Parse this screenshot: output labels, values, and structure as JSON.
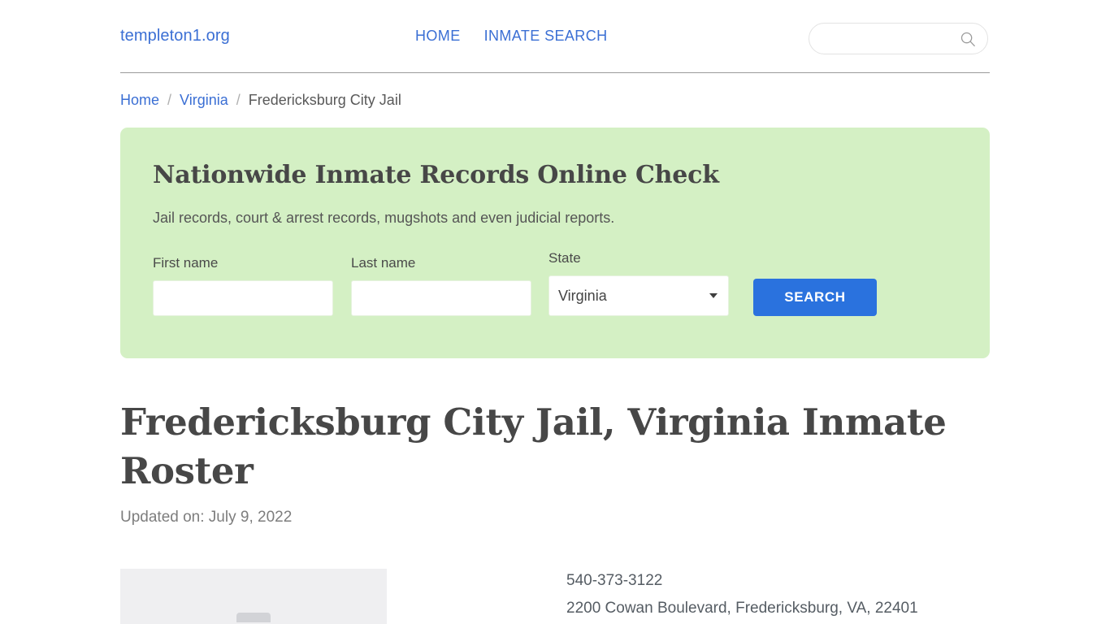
{
  "header": {
    "brand": "templeton1.org",
    "nav": [
      {
        "label": "HOME"
      },
      {
        "label": "INMATE SEARCH"
      }
    ],
    "search": {
      "value": "",
      "placeholder": "",
      "icon": "search-icon"
    }
  },
  "breadcrumb": {
    "items": [
      {
        "label": "Home",
        "type": "link"
      },
      {
        "label": "Virginia",
        "type": "link"
      },
      {
        "label": "Fredericksburg City Jail",
        "type": "current"
      }
    ],
    "separator": "/"
  },
  "search_panel": {
    "title": "Nationwide Inmate Records Online Check",
    "subtitle": "Jail records, court & arrest records, mugshots and even judicial reports.",
    "background_color": "#d4f0c4",
    "fields": {
      "first_name": {
        "label": "First name",
        "value": "",
        "placeholder": ""
      },
      "last_name": {
        "label": "Last name",
        "value": "",
        "placeholder": ""
      },
      "state": {
        "label": "State",
        "selected": "Virginia",
        "options": [
          "Virginia"
        ]
      }
    },
    "submit": {
      "label": "SEARCH",
      "color": "#2a72de"
    }
  },
  "main": {
    "title": "Fredericksburg City Jail, Virginia Inmate Roster",
    "updated": "Updated on: July 9, 2022",
    "photo": {
      "alt": "",
      "placeholder_color": "#efeff1"
    },
    "facility": {
      "phone": "540-373-3122",
      "address": "2200 Cowan Boulevard, Fredericksburg, VA, 22401"
    }
  },
  "theme": {
    "link_color": "#3b6fd4",
    "text_color": "#474747",
    "muted_color": "#7d7d7d"
  }
}
